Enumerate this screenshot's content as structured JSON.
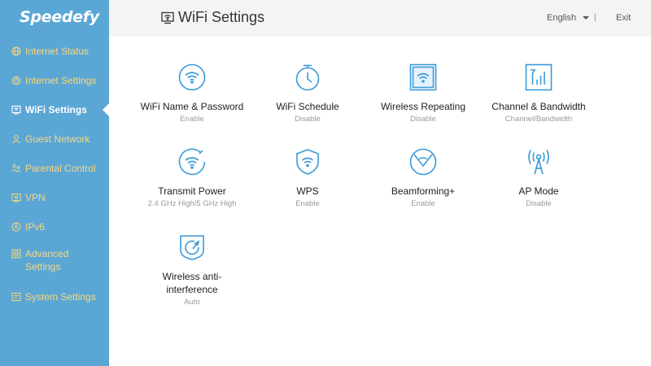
{
  "brand": {
    "name": "Speedefy"
  },
  "colors": {
    "sidebar": "#5aa7d6",
    "nav_text": "#f7d77e",
    "active_text": "#ffffff",
    "icon": "#3a9ad9",
    "header_bg": "#f4f4f4"
  },
  "sidebar": {
    "items": [
      {
        "label": "Internet Status",
        "icon": "globe-icon"
      },
      {
        "label": "Internet Settings",
        "icon": "settings-gear-icon"
      },
      {
        "label": "WiFi Settings",
        "icon": "wifi-monitor-icon",
        "active": true
      },
      {
        "label": "Guest Network",
        "icon": "user-icon"
      },
      {
        "label": "Parental Control",
        "icon": "family-icon"
      },
      {
        "label": "VPN",
        "icon": "vpn-icon"
      },
      {
        "label": "IPv6",
        "icon": "ipv6-icon"
      },
      {
        "label": "Advanced Settings",
        "icon": "grid-icon"
      },
      {
        "label": "System Settings",
        "icon": "system-icon"
      }
    ]
  },
  "header": {
    "title": "WiFi Settings",
    "language": "English",
    "separator": "|",
    "exit": "Exit"
  },
  "tiles": [
    {
      "name": "WiFi Name & Password",
      "status": "Enable",
      "icon": "wifi-circle-icon"
    },
    {
      "name": "WiFi Schedule",
      "status": "Disable",
      "icon": "clock-icon"
    },
    {
      "name": "Wireless Repeating",
      "status": "Disable",
      "icon": "wifi-square-icon"
    },
    {
      "name": "Channel & Bandwidth",
      "status": "Channel/Bandwidth",
      "icon": "signal-bars-icon"
    },
    {
      "name": "Transmit Power",
      "status": "2.4 GHz High/5 GHz High",
      "icon": "transmit-power-icon"
    },
    {
      "name": "WPS",
      "status": "Enable",
      "icon": "wps-shield-icon"
    },
    {
      "name": "Beamforming+",
      "status": "Enable",
      "icon": "beamforming-icon"
    },
    {
      "name": "AP Mode",
      "status": "Disable",
      "icon": "antenna-icon"
    },
    {
      "name": "Wireless anti-interference",
      "status": "Auto",
      "icon": "anti-interference-icon"
    }
  ]
}
